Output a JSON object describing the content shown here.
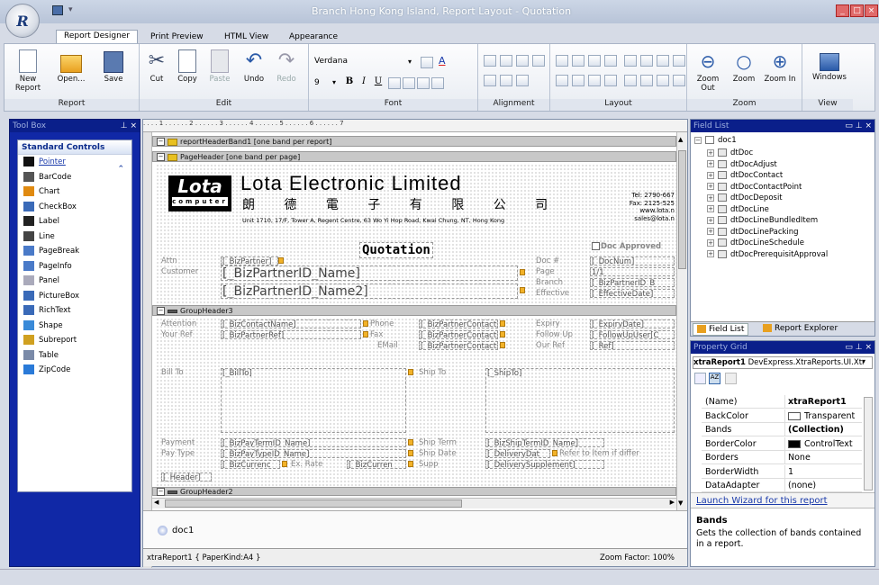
{
  "app": {
    "title": "Branch Hong Kong Island, Report Layout - Quotation",
    "logo": "R"
  },
  "tabs": [
    "Report Designer",
    "Print Preview",
    "HTML View",
    "Appearance"
  ],
  "ribbon": {
    "report": {
      "label": "Report",
      "new": "New Report",
      "open": "Open...",
      "save": "Save"
    },
    "edit": {
      "label": "Edit",
      "cut": "Cut",
      "copy": "Copy",
      "paste": "Paste",
      "undo": "Undo",
      "redo": "Redo"
    },
    "font": {
      "label": "Font",
      "family": "Verdana",
      "size": "9",
      "bold": "B",
      "italic": "I",
      "underline": "U"
    },
    "alignment": {
      "label": "Alignment"
    },
    "layout": {
      "label": "Layout"
    },
    "zoom": {
      "label": "Zoom",
      "out": "Zoom Out",
      "zoom": "Zoom",
      "in": "Zoom In"
    },
    "view": {
      "label": "View",
      "windows": "Windows"
    }
  },
  "toolbox": {
    "title": "Tool Box",
    "section": "Standard Controls",
    "items": [
      "Pointer",
      "BarCode",
      "Chart",
      "CheckBox",
      "Label",
      "Line",
      "PageBreak",
      "PageInfo",
      "Panel",
      "PictureBox",
      "RichText",
      "Shape",
      "Subreport",
      "Table",
      "ZipCode"
    ]
  },
  "designer": {
    "ruler": ". . . . 1 . . . . . . 2 . . . . . . 3 . . . . . . 4 . . . . . . 5 . . . . . . 6 . . . . . . 7",
    "bands": {
      "report_header": "reportHeaderBand1 [one band per report]",
      "page_header": "PageHeader [one band per page]",
      "group_header3": "GroupHeader3",
      "group_header2": "GroupHeader2"
    },
    "company": {
      "logo_top": "Lota",
      "logo_bottom": "computer",
      "name": "Lota Electronic Limited",
      "chinese": "朗 德 電 子 有 限 公 司",
      "address": "Unit 1710, 17/F, Tower A, Regent Centre, 63 Wo Yi Hop Road, Kwai Chung, NT, Hong Kong",
      "tel": "Tel: 2790-667",
      "fax": "Fax: 2125-525",
      "web": "www.lota.n",
      "email": "sales@lota.n"
    },
    "quotation": "Quotation",
    "doc_approved": "Doc Approved",
    "labels": {
      "attn": "Attn",
      "customer": "Customer",
      "doc_no": "Doc #",
      "page": "Page",
      "branch": "Branch",
      "effective": "Effective",
      "attention": "Attention",
      "your_ref": "Your Ref",
      "phone": "Phone",
      "fax": "Fax",
      "email": "EMail",
      "expiry": "Expiry",
      "follow_up": "Follow Up",
      "our_ref": "Our Ref",
      "bill_to": "Bill To",
      "ship_to": "Ship To",
      "payment": "Payment",
      "pay_type": "Pay Type",
      "ship_term": "Ship Term",
      "ship_date": "Ship Date",
      "ex_rate": "Ex. Rate",
      "supp": "Supp",
      "refer_item": "Refer to Item if differ"
    },
    "fields": {
      "bizpartner": "[_BizPartner]",
      "bizpartner_name1": "[_BizPartnerID_Name]",
      "bizpartner_name2": "[_BizPartnerID_Name2]",
      "docnum": "[_DocNum]",
      "page": "1/1",
      "branch": "[_BizPartnerID_B",
      "effective": "[_EffectiveDate]",
      "contact": "[_BizContactName]",
      "partnerref": "[_BizPartnerRef]",
      "contact_phone": "[_BizPartnerContactP",
      "contact_fax": "[_BizPartnerContactF",
      "contact_email": "[_BizPartnerContactE",
      "expiry": "[_ExpiryDate]",
      "followup": "[_FollowUpUser[C",
      "ref": "[_Ref]",
      "billto": "[_BillTo]",
      "shipto": "[_ShipTo]",
      "payterm": "[_BizPayTermID_Name]",
      "paytype": "[_BizPayTypeID_Name]",
      "currency1": "[_BizCurrenc",
      "currency2": "[_BizCurren",
      "shipterm": "[_BizShipTermID_Name]",
      "deliverydate": "[_DeliveryDat",
      "deliverysupp": "[_DeliverySupplement]",
      "header": "[_Header]"
    },
    "tray_item": "doc1",
    "status_left": "xtraReport1 { PaperKind:A4 }",
    "status_right": "Zoom Factor: 100%"
  },
  "fieldlist": {
    "title": "Field List",
    "root": "doc1",
    "items": [
      "dtDoc",
      "dtDocAdjust",
      "dtDocContact",
      "dtDocContactPoint",
      "dtDocDeposit",
      "dtDocLine",
      "dtDocLineBundledItem",
      "dtDocLinePacking",
      "dtDocLineSchedule",
      "dtDocPrerequisitApproval"
    ],
    "tab1": "Field List",
    "tab2": "Report Explorer"
  },
  "propgrid": {
    "title": "Property Grid",
    "object": "xtraReport1",
    "object_type": "DevExpress.XtraReports.UI.Xtr",
    "rows": [
      {
        "name": "(Name)",
        "value": "xtraReport1"
      },
      {
        "name": "BackColor",
        "value": "Transparent"
      },
      {
        "name": "Bands",
        "value": "(Collection)"
      },
      {
        "name": "BorderColor",
        "value": "ControlText"
      },
      {
        "name": "Borders",
        "value": "None"
      },
      {
        "name": "BorderWidth",
        "value": "1"
      },
      {
        "name": "DataAdapter",
        "value": "(none)"
      }
    ],
    "link": "Launch Wizard for this report",
    "desc_title": "Bands",
    "desc_text": "Gets the collection of bands contained in a report."
  }
}
